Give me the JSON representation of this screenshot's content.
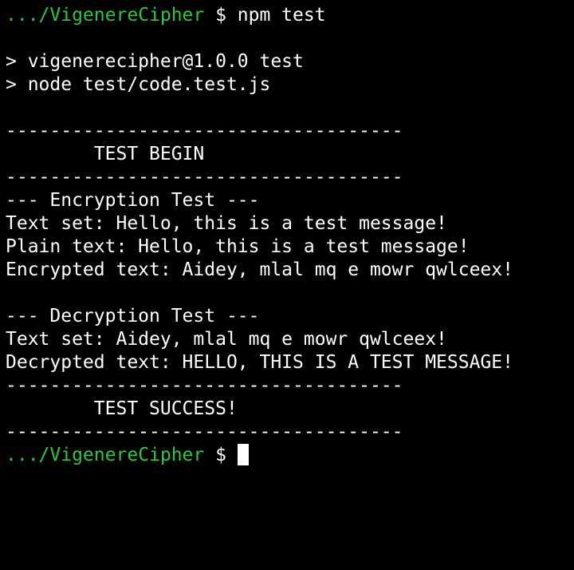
{
  "colors": {
    "background": "#000000",
    "text": "#ffffff",
    "prompt_path": "#27c93f",
    "cursor": "#ffffff"
  },
  "prompt": {
    "path": ".../VigenereCipher",
    "symbol": " $ ",
    "command": "npm test"
  },
  "lines": [
    "",
    "> vigenerecipher@1.0.0 test",
    "> node test/code.test.js",
    "",
    "------------------------------------",
    "        TEST BEGIN",
    "------------------------------------",
    "--- Encryption Test ---",
    "Text set: Hello, this is a test message!",
    "Plain text: Hello, this is a test message!",
    "Encrypted text: Aidey, mlal mq e mowr qwlceex!",
    "",
    "--- Decryption Test ---",
    "Text set: Aidey, mlal mq e mowr qwlceex!",
    "Decrypted text: HELLO, THIS IS A TEST MESSAGE!",
    "------------------------------------",
    "        TEST SUCCESS!",
    "------------------------------------"
  ],
  "final_prompt": {
    "path": ".../VigenereCipher",
    "symbol": " $ "
  }
}
